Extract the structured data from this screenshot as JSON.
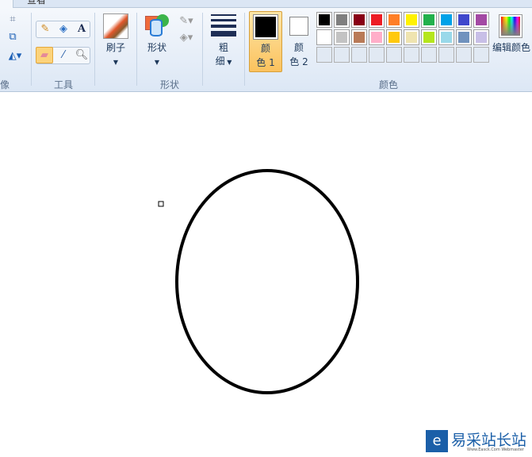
{
  "tabs": {
    "view": "查看"
  },
  "groups": {
    "image_partial": "像",
    "tools": "工具",
    "shapes": "形状",
    "colors": "颜色"
  },
  "buttons": {
    "brush": "刷子",
    "shapes": "形状",
    "size_line1": "粗",
    "size_line2": "细",
    "color1_line1": "颜",
    "color1_line2": "色 1",
    "color2_line1": "颜",
    "color2_line2": "色 2",
    "edit_colors": "编辑颜色"
  },
  "colors": {
    "color1": "#000000",
    "color2": "#ffffff",
    "palette_row1": [
      "#000000",
      "#7f7f7f",
      "#880015",
      "#ed1c24",
      "#ff7f27",
      "#fff200",
      "#22b14c",
      "#00a2e8",
      "#3f48cc",
      "#a349a4"
    ],
    "palette_row2": [
      "#ffffff",
      "#c3c3c3",
      "#b97a57",
      "#ffaec9",
      "#ffc90e",
      "#efe4b0",
      "#b5e61d",
      "#99d9ea",
      "#7092be",
      "#c8bfe7"
    ]
  },
  "watermark": {
    "text": "易采站长站",
    "sub": "Www.Easck.Com Webmaster"
  }
}
